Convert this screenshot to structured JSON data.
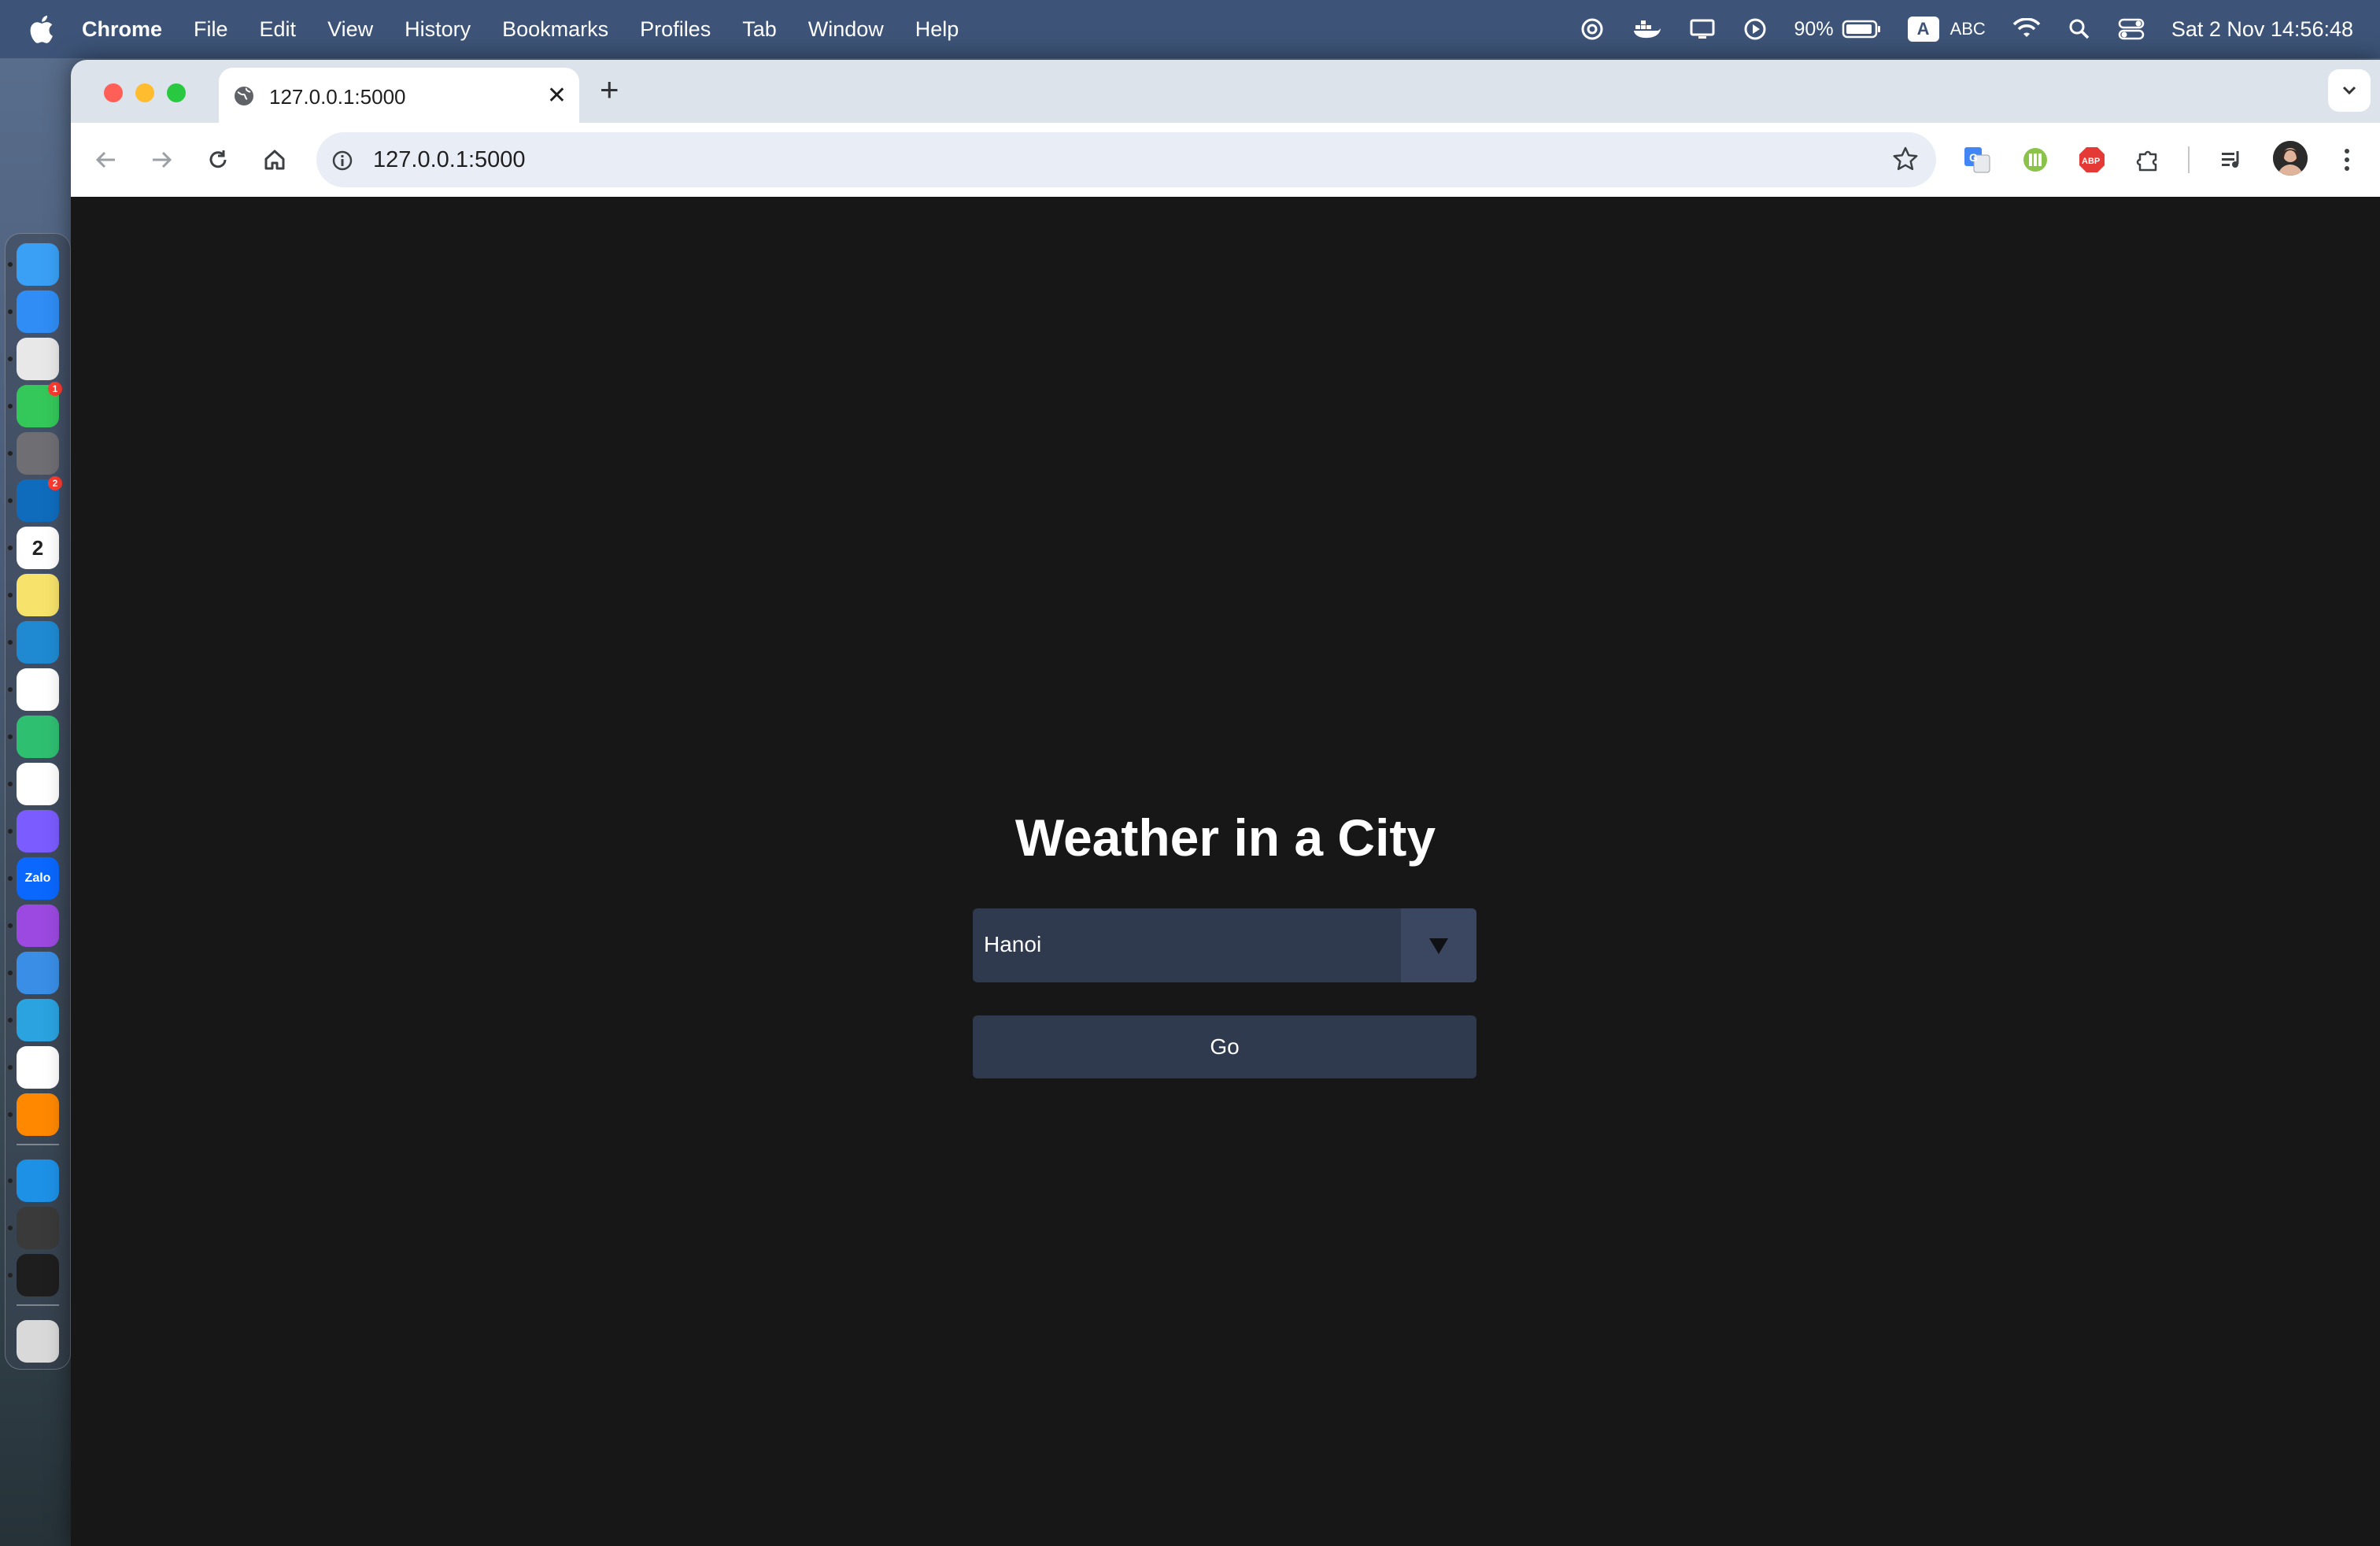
{
  "menubar": {
    "app_name": "Chrome",
    "items": [
      "File",
      "Edit",
      "View",
      "History",
      "Bookmarks",
      "Profiles",
      "Tab",
      "Window",
      "Help"
    ],
    "battery": "90%",
    "input_source_badge": "A",
    "input_source": "ABC",
    "clock": "Sat 2 Nov  14:56:48",
    "status_icons": [
      "chatgpt-icon",
      "docker-icon",
      "display-icon",
      "play-icon",
      "battery-icon",
      "wifi-icon",
      "spotlight-icon",
      "control-center-icon"
    ]
  },
  "dock": {
    "apps": [
      {
        "name": "finder",
        "color": "#3aa0f5"
      },
      {
        "name": "safari",
        "color": "#2f8df5"
      },
      {
        "name": "launchpad",
        "color": "#e8e8e8"
      },
      {
        "name": "messages",
        "color": "#34c759",
        "badge": "1"
      },
      {
        "name": "system-settings",
        "color": "#6e6e73"
      },
      {
        "name": "outlook",
        "color": "#0f6cbd",
        "badge": "2"
      },
      {
        "name": "calendar",
        "color": "#ffffff",
        "label": "2"
      },
      {
        "name": "notes",
        "color": "#f7e26b"
      },
      {
        "name": "vscode",
        "color": "#1f8ad2"
      },
      {
        "name": "chrome",
        "color": "#ffffff"
      },
      {
        "name": "app-green",
        "color": "#2fbf71"
      },
      {
        "name": "photos",
        "color": "#ffffff"
      },
      {
        "name": "messenger",
        "color": "#7b5cff"
      },
      {
        "name": "zalo",
        "color": "#0a68ff",
        "label": "Zalo"
      },
      {
        "name": "podcasts",
        "color": "#9b49e0"
      },
      {
        "name": "weather",
        "color": "#3a8ee6"
      },
      {
        "name": "telegram",
        "color": "#2aa3e0"
      },
      {
        "name": "chatgpt",
        "color": "#ffffff"
      },
      {
        "name": "vlc",
        "color": "#ff8800"
      },
      {
        "name": "docker",
        "color": "#1d91e6"
      },
      {
        "name": "app-dark",
        "color": "#3a3a3a"
      },
      {
        "name": "terminal",
        "color": "#1e1e1e"
      },
      {
        "name": "trash",
        "color": "#d9d9d9"
      }
    ]
  },
  "browser": {
    "tab_title": "127.0.0.1:5000",
    "url": "127.0.0.1:5000"
  },
  "page": {
    "title": "Weather in a City",
    "city_select": {
      "selected": "Hanoi"
    },
    "go_label": "Go"
  }
}
